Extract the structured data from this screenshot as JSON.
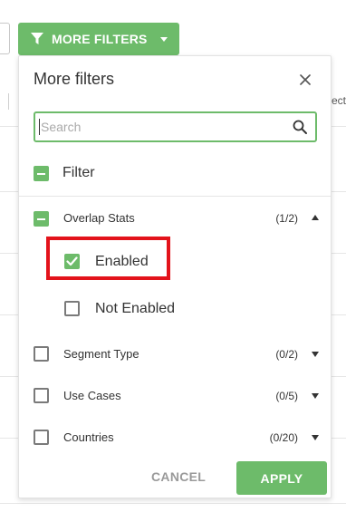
{
  "toolbar": {
    "more_filters_label": "MORE FILTERS",
    "accent_color": "#6dbb6a"
  },
  "background": {
    "column_header_fragment": "ect"
  },
  "panel": {
    "title": "More filters",
    "search": {
      "placeholder": "Search",
      "value": ""
    },
    "select_all_label": "Filter",
    "groups": [
      {
        "label": "Overlap Stats",
        "count": "(1/2)",
        "expanded": true,
        "state": "partial",
        "options": [
          {
            "label": "Enabled",
            "checked": true
          },
          {
            "label": "Not Enabled",
            "checked": false
          }
        ]
      },
      {
        "label": "Segment Type",
        "count": "(0/2)",
        "expanded": false,
        "state": "none"
      },
      {
        "label": "Use Cases",
        "count": "(0/5)",
        "expanded": false,
        "state": "none"
      },
      {
        "label": "Countries",
        "count": "(0/20)",
        "expanded": false,
        "state": "none"
      }
    ],
    "cancel_label": "CANCEL",
    "apply_label": "APPLY"
  },
  "annotation": {
    "highlight_color": "#e3131b"
  }
}
